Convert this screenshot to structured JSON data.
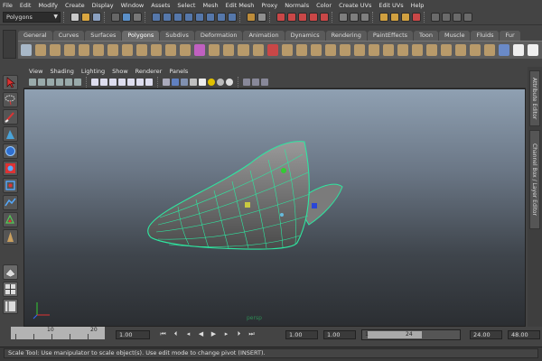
{
  "menubar": {
    "items": [
      "File",
      "Edit",
      "Modify",
      "Create",
      "Display",
      "Window",
      "Assets",
      "Select",
      "Mesh",
      "Edit Mesh",
      "Proxy",
      "Normals",
      "Color",
      "Create UVs",
      "Edit UVs",
      "Help"
    ]
  },
  "statusline": {
    "mode_value": "Polygons"
  },
  "shelf": {
    "tabs": [
      "General",
      "Curves",
      "Surfaces",
      "Polygons",
      "Subdivs",
      "Deformation",
      "Animation",
      "Dynamics",
      "Rendering",
      "PaintEffects",
      "Toon",
      "Muscle",
      "Fluids",
      "Fur"
    ],
    "active_tab": "Polygons"
  },
  "panel": {
    "menu": [
      "View",
      "Shading",
      "Lighting",
      "Show",
      "Renderer",
      "Panels"
    ],
    "camera_label": "persp"
  },
  "right_tabs": {
    "attribute_editor": "Attribute Editor",
    "channel_box": "Channel Box / Layer Editor"
  },
  "timeslider": {
    "tick_labels": [
      "10",
      "20"
    ],
    "current_frame": "1.00",
    "range_start": "1.00",
    "range_start2": "1.00",
    "range_slider_start": "1",
    "range_slider_end": "24",
    "range_end": "24.00",
    "anim_end": "48.00"
  },
  "helpline": {
    "text": "Scale Tool: Use manipulator to scale object(s). Use edit mode to change pivot (INSERT)."
  },
  "colors": {
    "wireframe": "#2ee6a0",
    "background": "#444444"
  }
}
